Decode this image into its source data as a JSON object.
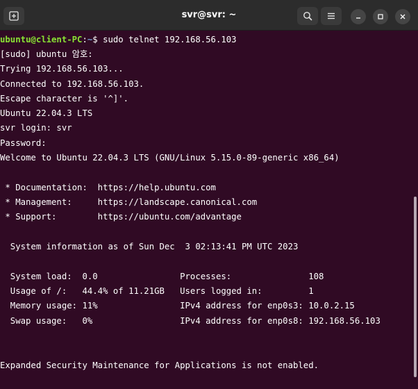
{
  "window": {
    "title": "svr@svr: ~"
  },
  "icons": {
    "new_tab": "new-tab-icon",
    "search": "search-icon",
    "menu": "hamburger-menu-icon",
    "minimize": "minimize-icon",
    "maximize": "maximize-icon",
    "close": "close-icon"
  },
  "colors": {
    "terminal_bg": "#300a24",
    "prompt_user_host": "#8ae234",
    "prompt_path": "#729fcf",
    "text": "#ffffff",
    "titlebar": "#2c2c2c"
  },
  "terminal": {
    "prompt": {
      "user_host": "ubuntu@client-PC",
      "path": "~",
      "symbol": "$",
      "command": " sudo telnet 192.168.56.103"
    },
    "lines": [
      "[sudo] ubuntu 암호:",
      "Trying 192.168.56.103...",
      "Connected to 192.168.56.103.",
      "Escape character is '^]'.",
      "Ubuntu 22.04.3 LTS",
      "svr login: svr",
      "Password:",
      "Welcome to Ubuntu 22.04.3 LTS (GNU/Linux 5.15.0-89-generic x86_64)",
      "",
      " * Documentation:  https://help.ubuntu.com",
      " * Management:     https://landscape.canonical.com",
      " * Support:        https://ubuntu.com/advantage",
      "",
      "  System information as of Sun Dec  3 02:13:41 PM UTC 2023",
      "",
      "  System load:  0.0                Processes:               108",
      "  Usage of /:   44.4% of 11.21GB   Users logged in:         1",
      "  Memory usage: 11%                IPv4 address for enp0s3: 10.0.2.15",
      "  Swap usage:   0%                 IPv4 address for enp0s8: 192.168.56.103",
      "",
      "",
      "Expanded Security Maintenance for Applications is not enabled."
    ]
  },
  "scrollbar": {
    "position_fraction": 0.5
  }
}
